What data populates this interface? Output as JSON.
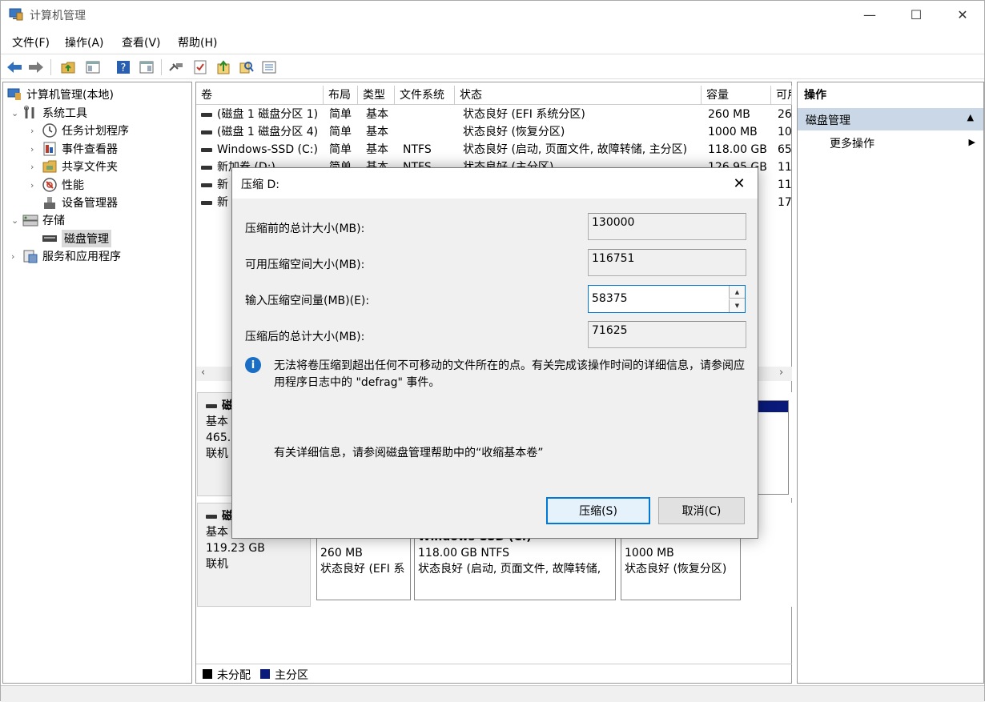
{
  "window": {
    "title": "计算机管理",
    "minimize": "—",
    "maximize": "☐",
    "close": "✕"
  },
  "menu": [
    "文件(F)",
    "操作(A)",
    "查看(V)",
    "帮助(H)"
  ],
  "tree": {
    "root": "计算机管理(本地)",
    "system_tools": "系统工具",
    "task_scheduler": "任务计划程序",
    "event_viewer": "事件查看器",
    "shared_folders": "共享文件夹",
    "performance": "性能",
    "device_manager": "设备管理器",
    "storage": "存储",
    "disk_management": "磁盘管理",
    "services_apps": "服务和应用程序"
  },
  "volumes": {
    "headers": [
      "卷",
      "布局",
      "类型",
      "文件系统",
      "状态",
      "容量",
      "可用"
    ],
    "rows": [
      [
        "(磁盘 1 磁盘分区 1)",
        "简单",
        "基本",
        "",
        "状态良好 (EFI 系统分区)",
        "260 MB",
        "26"
      ],
      [
        "(磁盘 1 磁盘分区 4)",
        "简单",
        "基本",
        "",
        "状态良好 (恢复分区)",
        "1000 MB",
        "10"
      ],
      [
        "Windows-SSD (C:)",
        "简单",
        "基本",
        "NTFS",
        "状态良好 (启动, 页面文件, 故障转储, 主分区)",
        "118.00 GB",
        "65"
      ],
      [
        "新加卷 (D:)",
        "简单",
        "基本",
        "NTFS",
        "状态良好 (主分区)",
        "126.95 GB",
        "11"
      ],
      [
        "新",
        "",
        "",
        "",
        "",
        "B",
        "11"
      ],
      [
        "新",
        "",
        "",
        "",
        "",
        "B",
        "17"
      ]
    ]
  },
  "disks": {
    "disk0": {
      "name": "磁",
      "type": "基本",
      "size": "465.",
      "status": "联机"
    },
    "disk1": {
      "name": "磁",
      "type": "基本",
      "size": "119.23 GB",
      "status": "联机"
    },
    "disk1_parts": [
      {
        "size": "260 MB",
        "status": "状态良好 (EFI 系"
      },
      {
        "title": "Windows-SSD (C:)",
        "size": "118.00 GB NTFS",
        "status": "状态良好 (启动, 页面文件, 故障转储,"
      },
      {
        "size": "1000 MB",
        "status": "状态良好 (恢复分区)"
      }
    ]
  },
  "legend": {
    "unallocated": "未分配",
    "primary": "主分区",
    "unallocated_color": "#000000",
    "primary_color": "#0a1a7a"
  },
  "actions": {
    "header": "操作",
    "section": "磁盘管理",
    "more": "更多操作"
  },
  "dialog": {
    "title": "压缩 D:",
    "total_before_label": "压缩前的总计大小(MB):",
    "total_before": "130000",
    "available_label": "可用压缩空间大小(MB):",
    "available": "116751",
    "amount_label": "输入压缩空间量(MB)(E):",
    "amount": "58375",
    "total_after_label": "压缩后的总计大小(MB):",
    "total_after": "71625",
    "info": "无法将卷压缩到超出任何不可移动的文件所在的点。有关完成该操作时间的详细信息，请参阅应用程序日志中的 \"defrag\" 事件。",
    "help": "有关详细信息，请参阅磁盘管理帮助中的“收缩基本卷”",
    "ok": "压缩(S)",
    "cancel": "取消(C)"
  }
}
